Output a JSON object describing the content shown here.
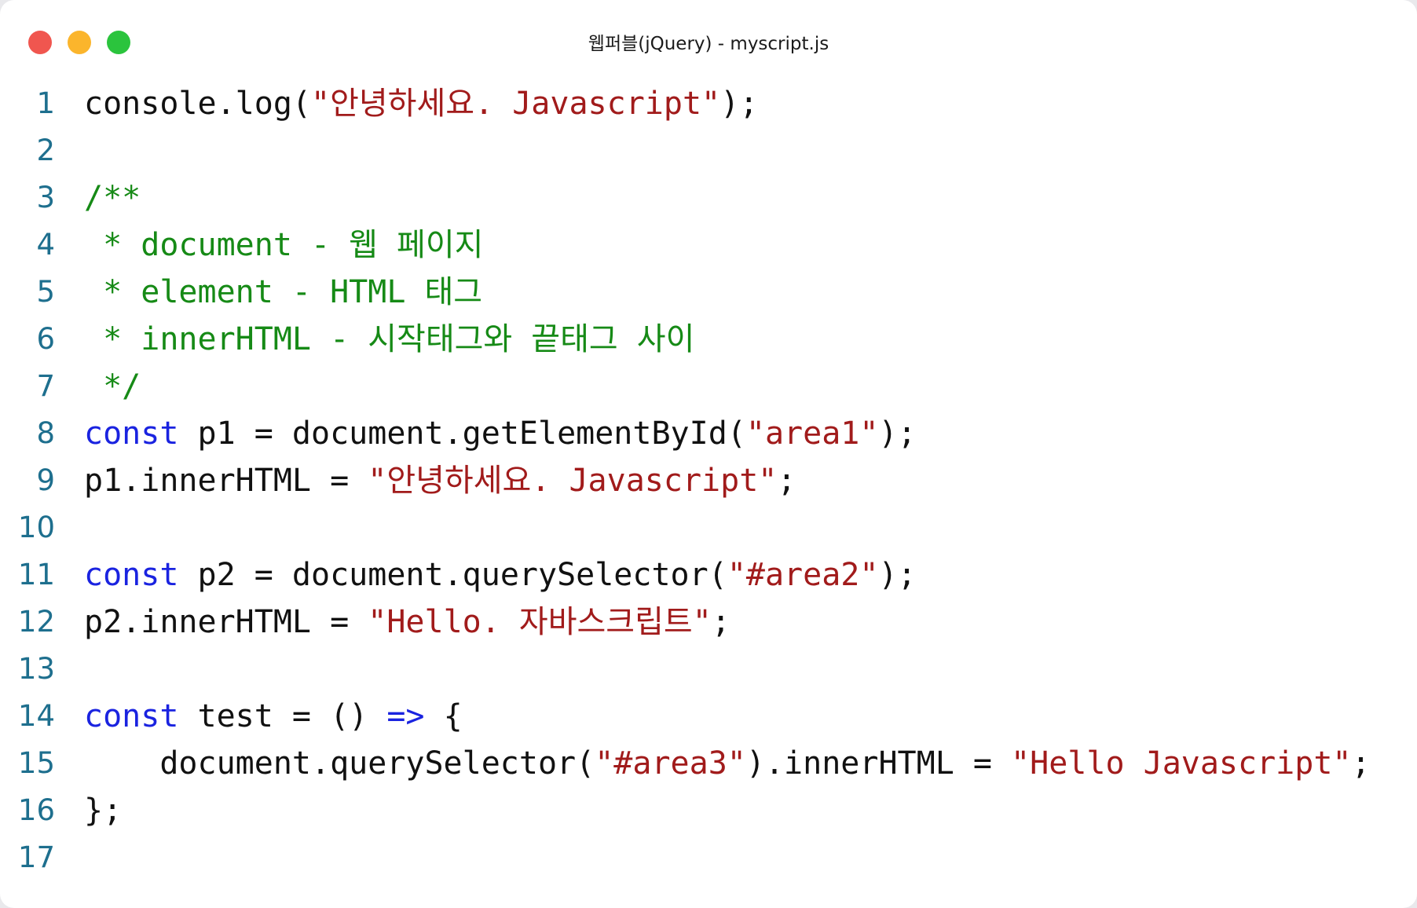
{
  "window": {
    "title": "웹퍼블(jQuery) - myscript.js",
    "controls": [
      {
        "name": "close-button",
        "color": "#f0564f"
      },
      {
        "name": "minimize-button",
        "color": "#fbb52c"
      },
      {
        "name": "zoom-button",
        "color": "#2bc43d"
      }
    ]
  },
  "colors": {
    "line_number": "#1e6f8e",
    "plain": "#111111",
    "string": "#a11b1b",
    "comment": "#168a16",
    "keyword": "#1a23e0"
  },
  "code": {
    "lines": [
      {
        "number": "1",
        "tokens": [
          {
            "type": "plain",
            "text": "console.log("
          },
          {
            "type": "string",
            "text": "\"안녕하세요. Javascript\""
          },
          {
            "type": "plain",
            "text": ");"
          }
        ]
      },
      {
        "number": "2",
        "tokens": []
      },
      {
        "number": "3",
        "tokens": [
          {
            "type": "comment",
            "text": "/**"
          }
        ]
      },
      {
        "number": "4",
        "tokens": [
          {
            "type": "comment",
            "text": " * document - 웹 페이지"
          }
        ]
      },
      {
        "number": "5",
        "tokens": [
          {
            "type": "comment",
            "text": " * element - HTML 태그"
          }
        ]
      },
      {
        "number": "6",
        "tokens": [
          {
            "type": "comment",
            "text": " * innerHTML - 시작태그와 끝태그 사이"
          }
        ]
      },
      {
        "number": "7",
        "tokens": [
          {
            "type": "comment",
            "text": " */"
          }
        ]
      },
      {
        "number": "8",
        "tokens": [
          {
            "type": "keyword",
            "text": "const"
          },
          {
            "type": "plain",
            "text": " p1 = document.getElementById("
          },
          {
            "type": "string",
            "text": "\"area1\""
          },
          {
            "type": "plain",
            "text": ");"
          }
        ]
      },
      {
        "number": "9",
        "tokens": [
          {
            "type": "plain",
            "text": "p1.innerHTML = "
          },
          {
            "type": "string",
            "text": "\"안녕하세요. Javascript\""
          },
          {
            "type": "plain",
            "text": ";"
          }
        ]
      },
      {
        "number": "10",
        "tokens": []
      },
      {
        "number": "11",
        "tokens": [
          {
            "type": "keyword",
            "text": "const"
          },
          {
            "type": "plain",
            "text": " p2 = document.querySelector("
          },
          {
            "type": "string",
            "text": "\"#area2\""
          },
          {
            "type": "plain",
            "text": ");"
          }
        ]
      },
      {
        "number": "12",
        "tokens": [
          {
            "type": "plain",
            "text": "p2.innerHTML = "
          },
          {
            "type": "string",
            "text": "\"Hello. 자바스크립트\""
          },
          {
            "type": "plain",
            "text": ";"
          }
        ]
      },
      {
        "number": "13",
        "tokens": []
      },
      {
        "number": "14",
        "tokens": [
          {
            "type": "keyword",
            "text": "const"
          },
          {
            "type": "plain",
            "text": " test = () "
          },
          {
            "type": "keyword",
            "text": "=>"
          },
          {
            "type": "plain",
            "text": " {"
          }
        ]
      },
      {
        "number": "15",
        "tokens": [
          {
            "type": "plain",
            "text": "    document.querySelector("
          },
          {
            "type": "string",
            "text": "\"#area3\""
          },
          {
            "type": "plain",
            "text": ").innerHTML = "
          },
          {
            "type": "string",
            "text": "\"Hello Javascript\""
          },
          {
            "type": "plain",
            "text": ";"
          }
        ]
      },
      {
        "number": "16",
        "tokens": [
          {
            "type": "plain",
            "text": "};"
          }
        ]
      },
      {
        "number": "17",
        "tokens": []
      }
    ]
  }
}
